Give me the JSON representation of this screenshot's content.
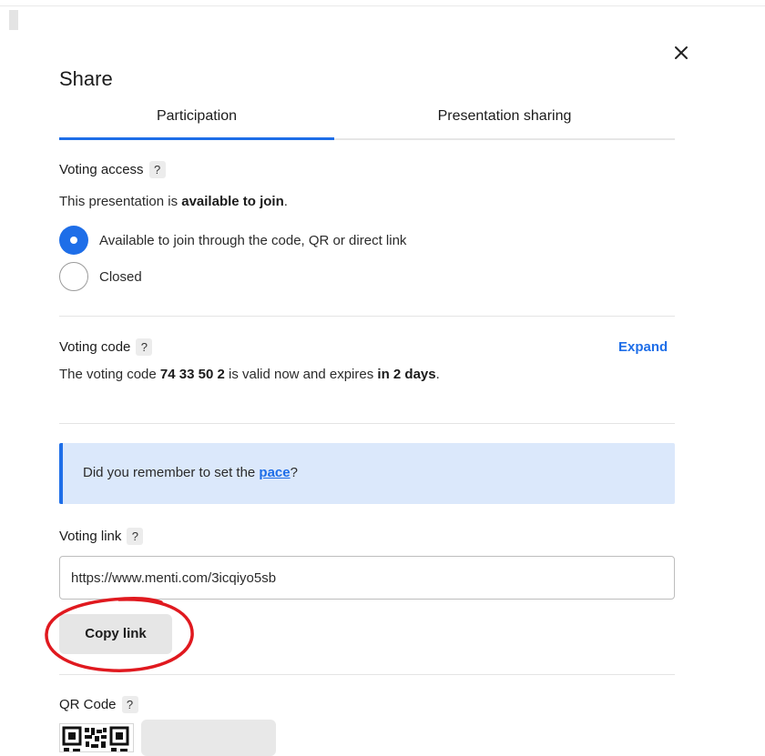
{
  "dialog": {
    "title": "Share",
    "close_icon": "close-icon"
  },
  "tabs": [
    {
      "label": "Participation",
      "active": true
    },
    {
      "label": "Presentation sharing",
      "active": false
    }
  ],
  "voting_access": {
    "label": "Voting access",
    "help": "?",
    "status_prefix": "This presentation is ",
    "status_value": "available to join",
    "status_suffix": ".",
    "options": [
      {
        "label": "Available to join through the code, QR or direct link",
        "selected": true
      },
      {
        "label": "Closed",
        "selected": false
      }
    ]
  },
  "voting_code": {
    "label": "Voting code",
    "help": "?",
    "expand": "Expand",
    "text_prefix": "The voting code ",
    "code": "74 33 50 2",
    "text_middle": " is valid now and expires ",
    "expiry": "in 2 days",
    "text_suffix": "."
  },
  "banner": {
    "prefix": "Did you remember to set the ",
    "link": "pace",
    "suffix": "?"
  },
  "voting_link": {
    "label": "Voting link",
    "help": "?",
    "url": "https://www.menti.com/3icqiyo5sb",
    "copy_button": "Copy link"
  },
  "qr_code": {
    "label": "QR Code",
    "help": "?"
  },
  "colors": {
    "accent": "#1e6ee8",
    "banner_bg": "#dbe8fb",
    "annotation": "#e0191f"
  }
}
